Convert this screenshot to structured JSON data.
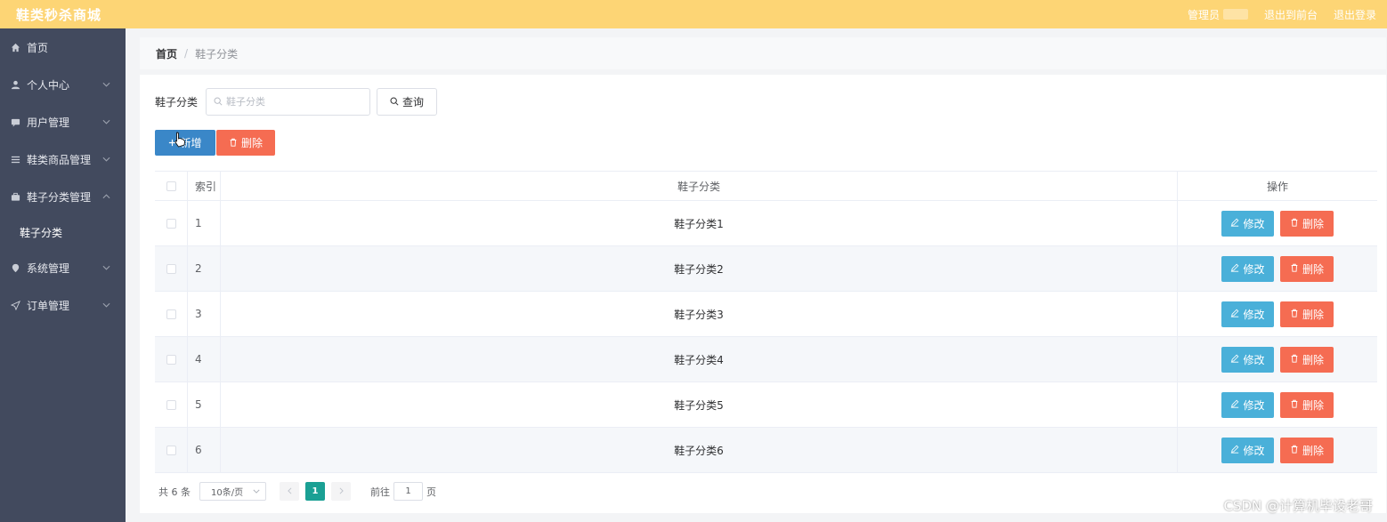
{
  "header": {
    "app_title": "鞋类秒杀商城",
    "admin_label": "管理员",
    "front_link": "退出到前台",
    "logout_link": "退出登录",
    "bg_color": "#fdd575"
  },
  "sidebar": {
    "bg_color": "#424a5e",
    "items": [
      {
        "label": "首页",
        "icon": "home-icon"
      },
      {
        "label": "个人中心",
        "icon": "user-icon"
      },
      {
        "label": "用户管理",
        "icon": "chat-icon"
      },
      {
        "label": "鞋类商品管理",
        "icon": "menu-icon"
      },
      {
        "label": "鞋子分类管理",
        "icon": "briefcase-icon"
      },
      {
        "label": "系统管理",
        "icon": "pin-icon"
      },
      {
        "label": "订单管理",
        "icon": "send-icon"
      }
    ],
    "sub_item": "鞋子分类"
  },
  "breadcrumb": {
    "home": "首页",
    "separator": "/",
    "current": "鞋子分类"
  },
  "search": {
    "label": "鞋子分类",
    "placeholder": "鞋子分类",
    "value": "",
    "query_button": "查询"
  },
  "actions": {
    "add_button": "新增",
    "delete_button": "删除"
  },
  "table": {
    "columns": [
      "索引",
      "鞋子分类",
      "操作"
    ],
    "rows": [
      {
        "index": "1",
        "name": "鞋子分类1"
      },
      {
        "index": "2",
        "name": "鞋子分类2"
      },
      {
        "index": "3",
        "name": "鞋子分类3"
      },
      {
        "index": "4",
        "name": "鞋子分类4"
      },
      {
        "index": "5",
        "name": "鞋子分类5"
      },
      {
        "index": "6",
        "name": "鞋子分类6"
      }
    ],
    "edit_label": "修改",
    "delete_label": "删除"
  },
  "pagination": {
    "total_text": "共 6 条",
    "page_size": "10条/页",
    "current_page": "1",
    "goto_prefix": "前往",
    "goto_value": "1",
    "goto_suffix": "页"
  },
  "watermark": "CSDN @计算机毕设老哥"
}
